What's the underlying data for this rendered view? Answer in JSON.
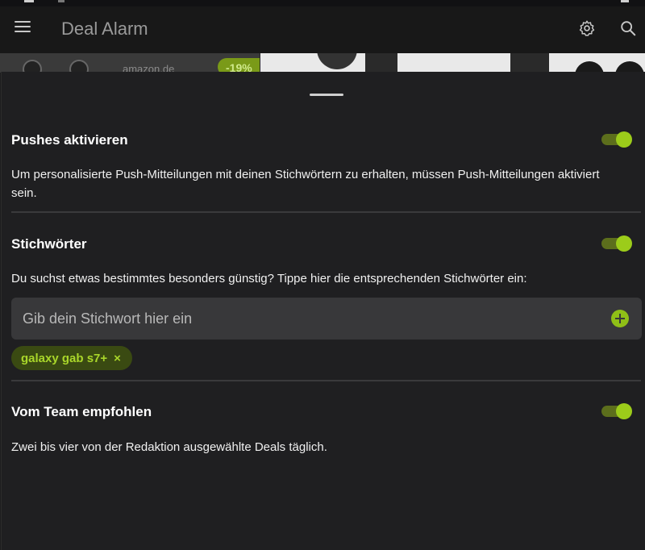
{
  "app": {
    "title": "Deal Alarm"
  },
  "background_card": {
    "merchant": "amazon.de",
    "discount_badge": "-19%"
  },
  "sections": {
    "pushes": {
      "title": "Pushes aktivieren",
      "description": "Um personalisierte Push-Mitteilungen mit deinen Stichwörtern zu erhalten, müssen Push-Mitteilungen aktiviert sein.",
      "enabled": true
    },
    "keywords": {
      "title": "Stichwörter",
      "description": "Du suchst etwas bestimmtes besonders günstig? Tippe hier die entsprechenden Stichwörter ein:",
      "enabled": true,
      "input_placeholder": "Gib dein Stichwort hier ein",
      "input_value": "",
      "chips": [
        {
          "label": "galaxy gab s7+",
          "close_glyph": "×"
        }
      ]
    },
    "team": {
      "title": "Vom Team empfohlen",
      "description": "Zwei bis vier von der Redaktion ausgewählte Deals täglich.",
      "enabled": true
    }
  },
  "colors": {
    "accent": "#9ccc1a",
    "toggle_track": "#5c6e1c",
    "chip_bg": "#3a4a12",
    "sheet_bg": "#1f1f21",
    "input_bg": "#38383a"
  },
  "icons": {
    "menu": "hamburger-menu-icon",
    "settings": "gear-icon",
    "search": "search-icon",
    "add": "plus-circle-icon",
    "remove_chip": "close-icon"
  }
}
